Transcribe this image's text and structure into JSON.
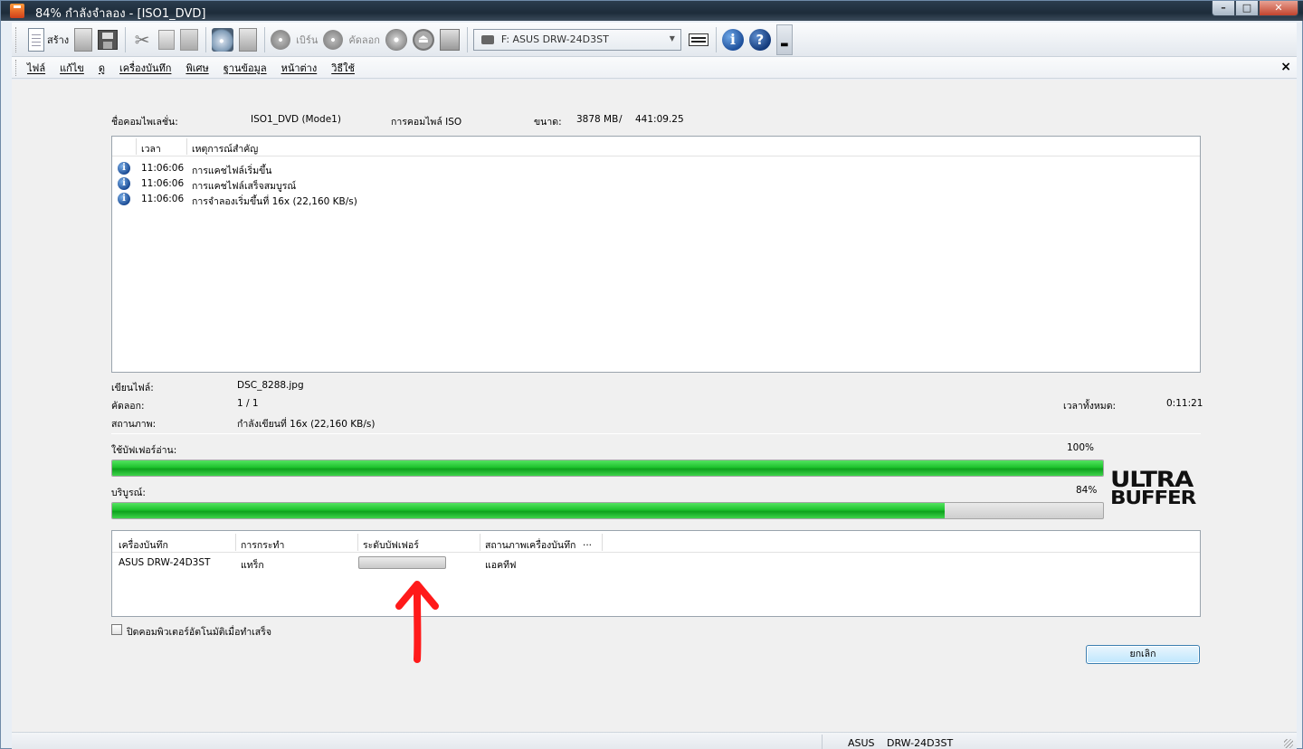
{
  "window": {
    "title": "84% กำลังจำลอง - [ISO1_DVD]",
    "buttons": {
      "minimize": "–",
      "maximize": "□",
      "close": "✕"
    }
  },
  "toolbar": {
    "new_label": "สร้าง",
    "burn_label": "เบิร์น",
    "copy_label": "คัดลอก",
    "drive_select": "F: ASUS DRW-24D3ST",
    "info_glyph": "i",
    "help_glyph": "?"
  },
  "menu": {
    "items": [
      "ไฟล์",
      "แก้ไข",
      "ดู",
      "เครื่องบันทึก",
      "พิเศษ",
      "ฐานข้อมูล",
      "หน้าต่าง",
      "วิธีใช้"
    ],
    "close": "×"
  },
  "compilation": {
    "name_label": "ชื่อคอมไพเลชั่น:",
    "name_value": "ISO1_DVD (Mode1)",
    "type_value": "การคอมไพล์ ISO",
    "size_label": "ขนาด:",
    "size_mb": "3878 MB",
    "size_sep": "/",
    "size_time": "441:09.25"
  },
  "log": {
    "col_time": "เวลา",
    "col_event": "เหตุการณ์สำคัญ",
    "rows": [
      {
        "time": "11:06:06",
        "event": "การแคชไฟล์เริ่มขึ้น"
      },
      {
        "time": "11:06:06",
        "event": "การแคชไฟล์เสร็จสมบูรณ์"
      },
      {
        "time": "11:06:06",
        "event": "การจำลองเริ่มขึ้นที่ 16x (22,160 KB/s)"
      }
    ]
  },
  "status": {
    "writing_label": "เขียนไฟล์:",
    "writing_value": "DSC_8288.jpg",
    "copy_label": "คัดลอก:",
    "copy_value": "1 / 1",
    "state_label": "สถานภาพ:",
    "state_value": "กำลังเขียนที่ 16x (22,160 KB/s)",
    "total_time_label": "เวลาทั้งหมด:",
    "total_time_value": "0:11:21"
  },
  "progress": {
    "buffer_label": "ใช้บัฟเฟอร์อ่าน:",
    "buffer_pct_text": "100%",
    "buffer_fraction": 1.0,
    "complete_label": "บริบูรณ์:",
    "complete_pct_text": "84%",
    "complete_fraction": 0.84
  },
  "logo": {
    "line1": "ULTRA",
    "line2": "BUFFER"
  },
  "recorders": {
    "col_recorder": "เครื่องบันทึก",
    "col_action": "การกระทำ",
    "col_buffer": "ระดับบัฟเฟอร์",
    "col_state": "สถานภาพเครื่องบันทึก",
    "col_more": "...",
    "rows": [
      {
        "recorder": "ASUS DRW-24D3ST",
        "action": "แทร็ก",
        "buffer_fraction": 0.0,
        "state": "แอคทีฟ"
      }
    ]
  },
  "shutdown_checkbox_label": "ปิดคอมพิวเตอร์อัตโนมัติเมื่อทำเสร็จ",
  "cancel_label": "ยกเลิก",
  "statusbar": {
    "brand": "ASUS",
    "model": "DRW-24D3ST"
  },
  "colors": {
    "progress_green": "#1ec22d",
    "annotation_red": "#ff1a1a",
    "accent_blue": "#1d4f9b"
  }
}
